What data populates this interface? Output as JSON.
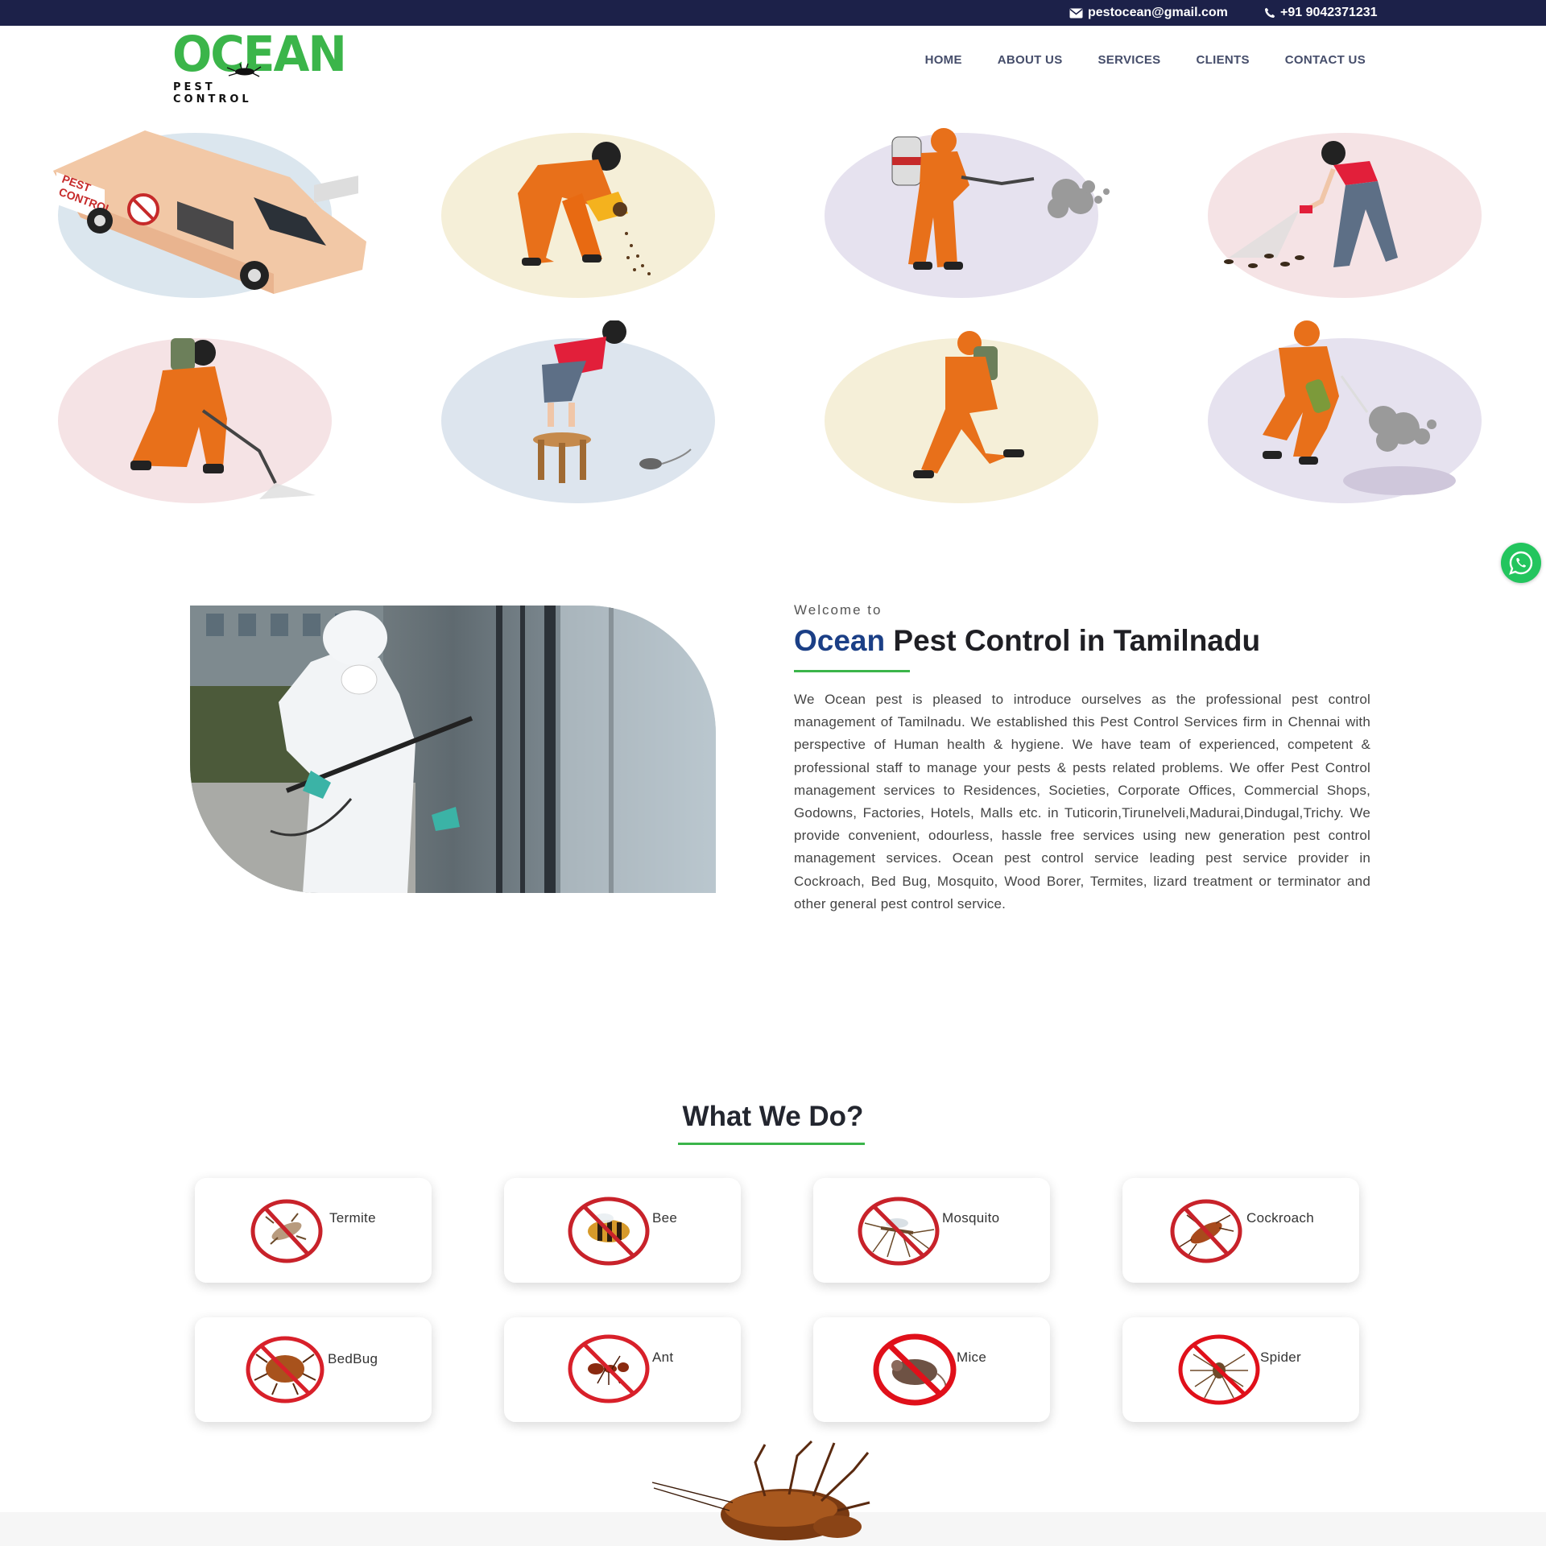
{
  "topbar": {
    "email": "pestocean@gmail.com",
    "phone": "+91 9042371231",
    "bg": "#1c2149"
  },
  "logo": {
    "word": "OCEAN",
    "tagline": "PEST CONTROL"
  },
  "nav": {
    "items": [
      "HOME",
      "ABOUT US",
      "SERVICES",
      "CLIENTS",
      "CONTACT US"
    ]
  },
  "illustrations": [
    {
      "icon": "pest-control-van-icon",
      "bg": "#dbe6ee"
    },
    {
      "icon": "worker-spreading-granules-icon",
      "bg": "#f5efd8"
    },
    {
      "icon": "worker-spraying-fog-icon",
      "bg": "#e6e2ef"
    },
    {
      "icon": "woman-spraying-cockroaches-icon",
      "bg": "#f5e3e5"
    },
    {
      "icon": "worker-spraying-floor-icon",
      "bg": "#f5e3e5"
    },
    {
      "icon": "woman-on-stool-rat-icon",
      "bg": "#dde5ee"
    },
    {
      "icon": "worker-with-backpack-sprayer-icon",
      "bg": "#f5efd8"
    },
    {
      "icon": "worker-fumigating-icon",
      "bg": "#e6e2ef"
    }
  ],
  "about": {
    "welcome": "Welcome to",
    "brand": "Ocean",
    "title_rest": " Pest Control in Tamilnadu",
    "body": "We Ocean pest is pleased to introduce ourselves as the professional pest control management of Tamilnadu. We established this Pest Control Services firm in Chennai with perspective of Human health & hygiene. We have team of experienced, competent & professional staff to manage your pests & pests related problems. We offer Pest Control management services to Residences, Societies, Corporate Offices, Commercial Shops, Godowns, Factories, Hotels, Malls etc. in Tuticorin,Tirunelveli,Madurai,Dindugal,Trichy. We provide convenient, odourless, hassle free services using new generation pest control management services. Ocean pest control service leading pest service provider in Cockroach, Bed Bug, Mosquito, Wood Borer, Termites, lizard treatment or terminator and other general pest control service.",
    "accent": "#3bb54a",
    "brand_color": "#1b3f86"
  },
  "services": {
    "title": "What We Do?",
    "items": [
      {
        "label": "Termite",
        "icon": "no-termite-icon"
      },
      {
        "label": "Bee",
        "icon": "no-bee-icon"
      },
      {
        "label": "Mosquito",
        "icon": "no-mosquito-icon"
      },
      {
        "label": "Cockroach",
        "icon": "no-cockroach-icon"
      },
      {
        "label": "BedBug",
        "icon": "no-bedbug-icon"
      },
      {
        "label": "Ant",
        "icon": "no-ant-icon"
      },
      {
        "label": "Mice",
        "icon": "no-mice-icon"
      },
      {
        "label": "Spider",
        "icon": "no-spider-icon"
      }
    ]
  },
  "whatsapp": {
    "icon": "whatsapp-icon",
    "color": "#23c55e"
  }
}
